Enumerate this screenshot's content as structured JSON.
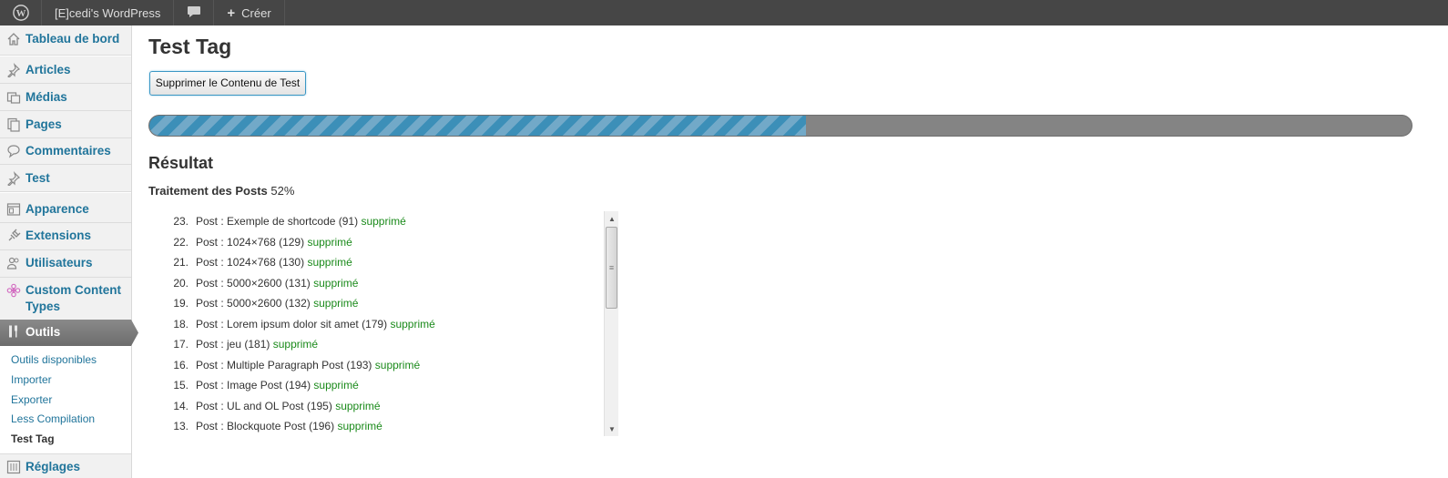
{
  "adminbar": {
    "wp_icon": "wordpress-logo-icon",
    "site_name": "[E]cedi's WordPress",
    "comment_icon": "speech-bubble-icon",
    "new_label": "Créer",
    "new_icon": "plus-icon"
  },
  "sidebar": {
    "items": [
      {
        "label": "Tableau de bord",
        "icon": "home-icon"
      },
      {
        "label": "Articles",
        "icon": "pushpin-icon"
      },
      {
        "label": "Médias",
        "icon": "media-icon"
      },
      {
        "label": "Pages",
        "icon": "pages-icon"
      },
      {
        "label": "Commentaires",
        "icon": "comment-icon"
      },
      {
        "label": "Test",
        "icon": "pushpin-icon"
      },
      {
        "label": "Apparence",
        "icon": "appearance-icon"
      },
      {
        "label": "Extensions",
        "icon": "plugin-icon"
      },
      {
        "label": "Utilisateurs",
        "icon": "users-icon"
      },
      {
        "label": "Custom Content Types",
        "icon": "flower-icon"
      },
      {
        "label": "Outils",
        "icon": "tools-icon"
      },
      {
        "label": "Réglages",
        "icon": "settings-icon"
      }
    ],
    "submenu": [
      {
        "label": "Outils disponibles"
      },
      {
        "label": "Importer"
      },
      {
        "label": "Exporter"
      },
      {
        "label": "Less Compilation"
      },
      {
        "label": "Test Tag",
        "current": true
      }
    ]
  },
  "main": {
    "title": "Test Tag",
    "button_label": "Supprimer le Contenu de Test",
    "progress_percent": 52,
    "result_title": "Résultat",
    "processing_label": "Traitement des Posts",
    "processing_value": "52%",
    "log": [
      {
        "num": "23.",
        "text": "Post : Exemple de shortcode (91)",
        "status": "supprimé"
      },
      {
        "num": "22.",
        "text": "Post : 1024×768 (129)",
        "status": "supprimé"
      },
      {
        "num": "21.",
        "text": "Post : 1024×768 (130)",
        "status": "supprimé"
      },
      {
        "num": "20.",
        "text": "Post : 5000×2600 (131)",
        "status": "supprimé"
      },
      {
        "num": "19.",
        "text": "Post : 5000×2600 (132)",
        "status": "supprimé"
      },
      {
        "num": "18.",
        "text": "Post : Lorem ipsum dolor sit amet (179)",
        "status": "supprimé"
      },
      {
        "num": "17.",
        "text": "Post : jeu (181)",
        "status": "supprimé"
      },
      {
        "num": "16.",
        "text": "Post : Multiple Paragraph Post (193)",
        "status": "supprimé"
      },
      {
        "num": "15.",
        "text": "Post : Image Post (194)",
        "status": "supprimé"
      },
      {
        "num": "14.",
        "text": "Post : UL and OL Post (195)",
        "status": "supprimé"
      },
      {
        "num": "13.",
        "text": "Post : Blockquote Post (196)",
        "status": "supprimé"
      }
    ]
  },
  "colors": {
    "adminbar_bg": "#464646",
    "link": "#21759b",
    "active_menu": "#777777",
    "progress_fill": "#3c8fb8",
    "progress_track": "#848484",
    "status_green": "#1a8a1a"
  }
}
